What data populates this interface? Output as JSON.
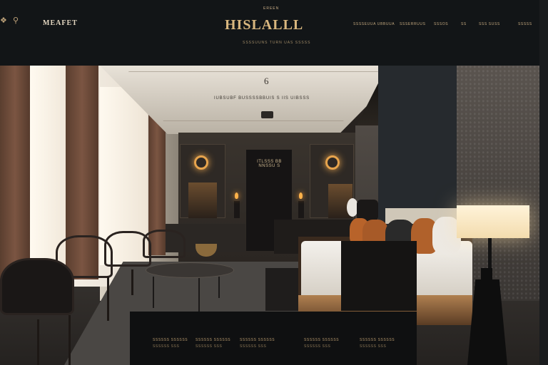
{
  "header": {
    "top_left_glyphs": [
      "❖",
      "⚲"
    ],
    "brand_left": "MEAFET",
    "eyebrow": "EREEN",
    "logo": "HISLALLL",
    "tagline": "SSSSUUNS TURN UAS SSSSS",
    "nav": [
      "SSSSEUUA UBBUUA",
      "SSSERRUUS",
      "SSSOS",
      "SS",
      "SSS SUSS",
      "SSSSS"
    ]
  },
  "hero": {
    "number": "6",
    "caption": "IUBSUBF BUSSSSBBUIS S IIS UIBSSS",
    "door_sign": [
      "ITLSSS BB",
      "NNSSU S"
    ]
  },
  "footer_links": [
    {
      "line1": "SSSSSS SSSSSS",
      "line2": "SSSSSS SSS"
    },
    {
      "line1": "SSSSSS SSSSSS",
      "line2": "SSSSSS SSS"
    },
    {
      "line1": "SSSSSS SSSSSS",
      "line2": "SSSSSS SSS"
    },
    {
      "line1": "SSSSSS SSSSSS",
      "line2": "SSSSSS SSS"
    },
    {
      "line1": "SSSSSS SSSSSS",
      "line2": "SSSSSS SSS"
    }
  ],
  "colors": {
    "header_bg": "#121517",
    "accent_gold": "#d9b77f",
    "lamp_glow": "#fff3d9"
  }
}
